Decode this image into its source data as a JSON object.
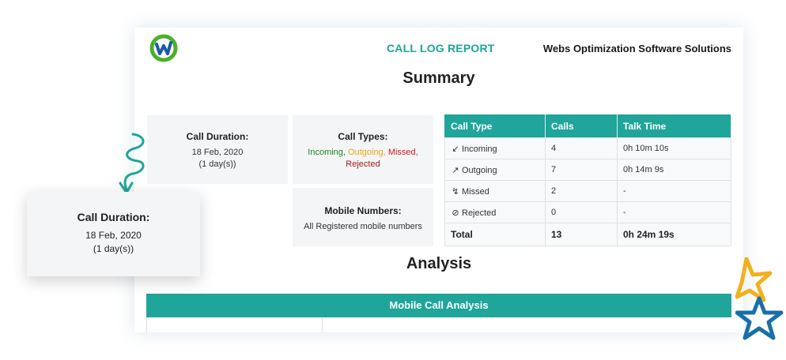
{
  "header": {
    "title": "CALL LOG REPORT",
    "company": "Webs Optimization Software Solutions"
  },
  "sections": {
    "summary": "Summary",
    "analysis": "Analysis"
  },
  "cards": {
    "duration": {
      "heading": "Call Duration:",
      "date": "18 Feb, 2020",
      "days": "(1 day(s))"
    },
    "types": {
      "heading": "Call Types:",
      "incoming": "Incoming,",
      "outgoing": "Outgoing,",
      "missed": "Missed,",
      "rejected": "Rejected"
    },
    "mobile": {
      "heading": "Mobile Numbers:",
      "value": "All Registered mobile numbers"
    }
  },
  "call_table": {
    "headers": [
      "Call Type",
      "Calls",
      "Talk Time"
    ],
    "rows": [
      {
        "type": "Incoming",
        "calls": "4",
        "talk": "0h 10m 10s",
        "icon": "incoming-arrow-icon",
        "color": "#148a1e"
      },
      {
        "type": "Outgoing",
        "calls": "7",
        "talk": "0h 14m 9s",
        "icon": "outgoing-arrow-icon",
        "color": "#e8a613"
      },
      {
        "type": "Missed",
        "calls": "2",
        "talk": "-",
        "icon": "missed-call-icon",
        "color": "#d01c1c"
      },
      {
        "type": "Rejected",
        "calls": "0",
        "talk": "-",
        "icon": "rejected-call-icon",
        "color": "#a01d1d"
      }
    ],
    "total": {
      "label": "Total",
      "calls": "13",
      "talk": "0h 24m 19s"
    }
  },
  "analysis": {
    "bar_title": "Mobile Call Analysis"
  },
  "callout": {
    "heading": "Call Duration:",
    "date": "18 Feb, 2020",
    "days": "(1 day(s))"
  },
  "colors": {
    "accent": "#1fa59a",
    "incoming": "#148a1e",
    "outgoing": "#e8a613",
    "missed": "#d01c1c",
    "rejected": "#a01d1d",
    "logo_green": "#4caf2a",
    "logo_blue": "#1a5aa6",
    "star_yellow": "#f2b01e",
    "star_blue": "#1a6fa8"
  }
}
